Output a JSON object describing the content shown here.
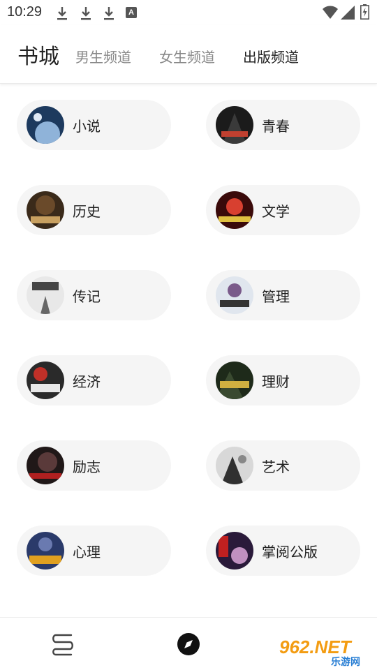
{
  "status_bar": {
    "time": "10:29",
    "icons": [
      "download-icon",
      "download-icon",
      "download-icon",
      "font-a-icon",
      "wifi-icon",
      "signal-icon",
      "battery-charging-icon"
    ],
    "a_glyph": "A"
  },
  "header": {
    "title": "书城",
    "tabs": [
      {
        "label": "男生频道",
        "active": false
      },
      {
        "label": "女生频道",
        "active": false
      },
      {
        "label": "出版频道",
        "active": true
      }
    ]
  },
  "categories": [
    {
      "label": "小说",
      "icon": "book-cover-moon",
      "colors": [
        "#1d3a5e",
        "#8fb3d9"
      ]
    },
    {
      "label": "青春",
      "icon": "book-cover-warrior",
      "colors": [
        "#1b1b1b",
        "#c04030"
      ]
    },
    {
      "label": "历史",
      "icon": "book-cover-battle",
      "colors": [
        "#3a2a1a",
        "#c8a060"
      ]
    },
    {
      "label": "文学",
      "icon": "book-cover-red",
      "colors": [
        "#3a0a0a",
        "#d84030"
      ]
    },
    {
      "label": "传记",
      "icon": "book-cover-ink",
      "colors": [
        "#e8e8e8",
        "#444444"
      ]
    },
    {
      "label": "管理",
      "icon": "book-cover-hero",
      "colors": [
        "#e0e6ee",
        "#7a5a8a"
      ]
    },
    {
      "label": "经济",
      "icon": "book-cover-sword",
      "colors": [
        "#2a2a2a",
        "#c03028"
      ]
    },
    {
      "label": "理财",
      "icon": "book-cover-forest",
      "colors": [
        "#1e2a1a",
        "#d0b040"
      ]
    },
    {
      "label": "励志",
      "icon": "book-cover-dark",
      "colors": [
        "#201818",
        "#b02020"
      ]
    },
    {
      "label": "艺术",
      "icon": "book-cover-mist",
      "colors": [
        "#d8d8d8",
        "#303030"
      ]
    },
    {
      "label": "心理",
      "icon": "book-cover-sky",
      "colors": [
        "#2a3a6a",
        "#e0a020"
      ]
    },
    {
      "label": "掌阅公版",
      "icon": "book-cover-purple",
      "colors": [
        "#2a1a3a",
        "#c090c0"
      ]
    }
  ],
  "bottom_nav": {
    "items": [
      "bookshelf-icon",
      "discover-compass-icon"
    ]
  },
  "watermark": {
    "brand": "962.NET",
    "sub": "乐游网"
  }
}
